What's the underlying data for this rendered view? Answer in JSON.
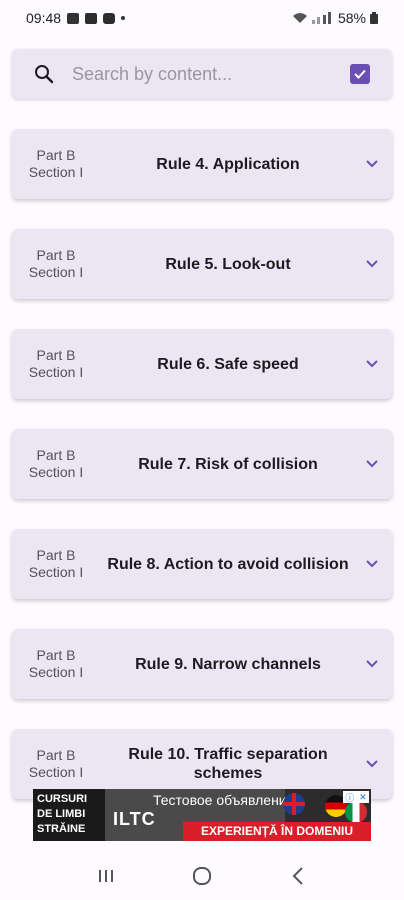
{
  "status_bar": {
    "time": "09:48",
    "battery": "58%"
  },
  "search": {
    "placeholder": "Search by content...",
    "value": "",
    "checkbox_checked": true
  },
  "rules": [
    {
      "part": "Part B",
      "section": "Section I",
      "title": "Rule 4. Application"
    },
    {
      "part": "Part B",
      "section": "Section I",
      "title": "Rule 5. Look-out"
    },
    {
      "part": "Part B",
      "section": "Section I",
      "title": "Rule 6. Safe speed"
    },
    {
      "part": "Part B",
      "section": "Section I",
      "title": "Rule 7. Risk of collision"
    },
    {
      "part": "Part B",
      "section": "Section I",
      "title": "Rule 8. Action to avoid collision"
    },
    {
      "part": "Part B",
      "section": "Section I",
      "title": "Rule 9. Narrow channels"
    },
    {
      "part": "Part B",
      "section": "Section I",
      "title": "Rule 10. Traffic separation schemes"
    }
  ],
  "ad": {
    "left_text": "CURSURI DE LIMBI STRĂINE",
    "headline": "Тестовое объявление",
    "logo": "ILTC",
    "strip": "EXPERIENȚĂ ÎN DOMENIU"
  },
  "colors": {
    "accent": "#6a4fb2",
    "card_bg": "#ece6f4",
    "page_bg": "#fdfbff"
  },
  "icons": {
    "search": "search-icon",
    "checkbox": "checkbox-checked-icon",
    "chevron": "chevron-down-icon",
    "recents": "recents-icon",
    "home": "home-icon",
    "back": "back-icon"
  }
}
